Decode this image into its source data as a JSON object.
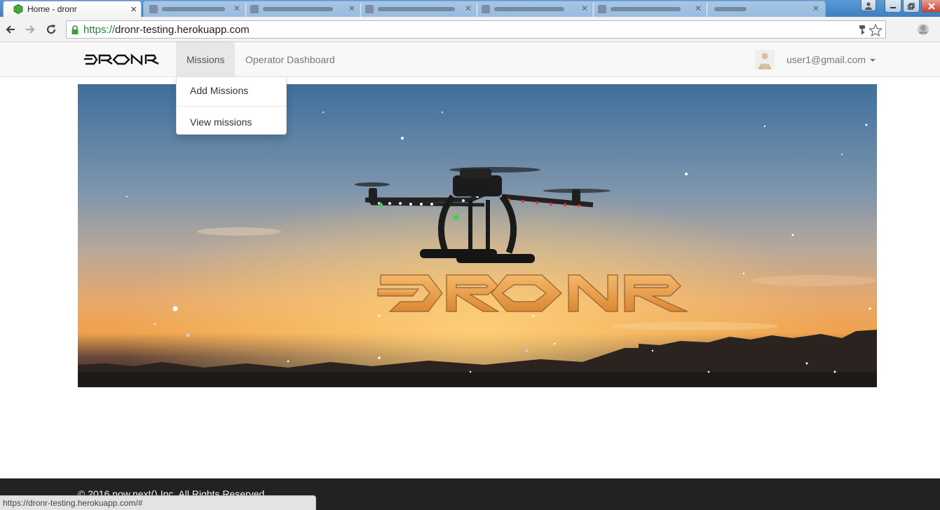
{
  "browser": {
    "active_tab": {
      "title": "Home - dronr",
      "close": "×"
    },
    "background_tabs": [
      {
        "label": ""
      },
      {
        "label": ""
      },
      {
        "label": ""
      },
      {
        "label": ""
      },
      {
        "label": ""
      },
      {
        "label": ""
      },
      {
        "label": ""
      }
    ],
    "url_scheme": "https://",
    "url_host": "dronr-testing.herokuapp.com",
    "status_url": "https://dronr-testing.herokuapp.com/#"
  },
  "nav": {
    "brand": "DRONR",
    "missions_label": "Missions",
    "operator_label": "Operator Dashboard",
    "user_email": "user1@gmail.com"
  },
  "missions_dropdown": {
    "items": [
      "Add Missions",
      "View missions"
    ]
  },
  "hero": {
    "logo_text": "DRONR"
  },
  "footer": {
    "copyright": "© 2016 now.next() Inc. All Rights Reserved."
  },
  "colors": {
    "secure_green": "#1d8a2a",
    "navbar_bg": "#f8f8f8",
    "footer_bg": "#222222",
    "hero_logo": "#e8a04a"
  },
  "icons": [
    "back-icon",
    "forward-icon",
    "reload-icon",
    "lock-icon",
    "key-icon",
    "star-icon",
    "extension-icon",
    "user-avatar",
    "caret-down-icon"
  ]
}
